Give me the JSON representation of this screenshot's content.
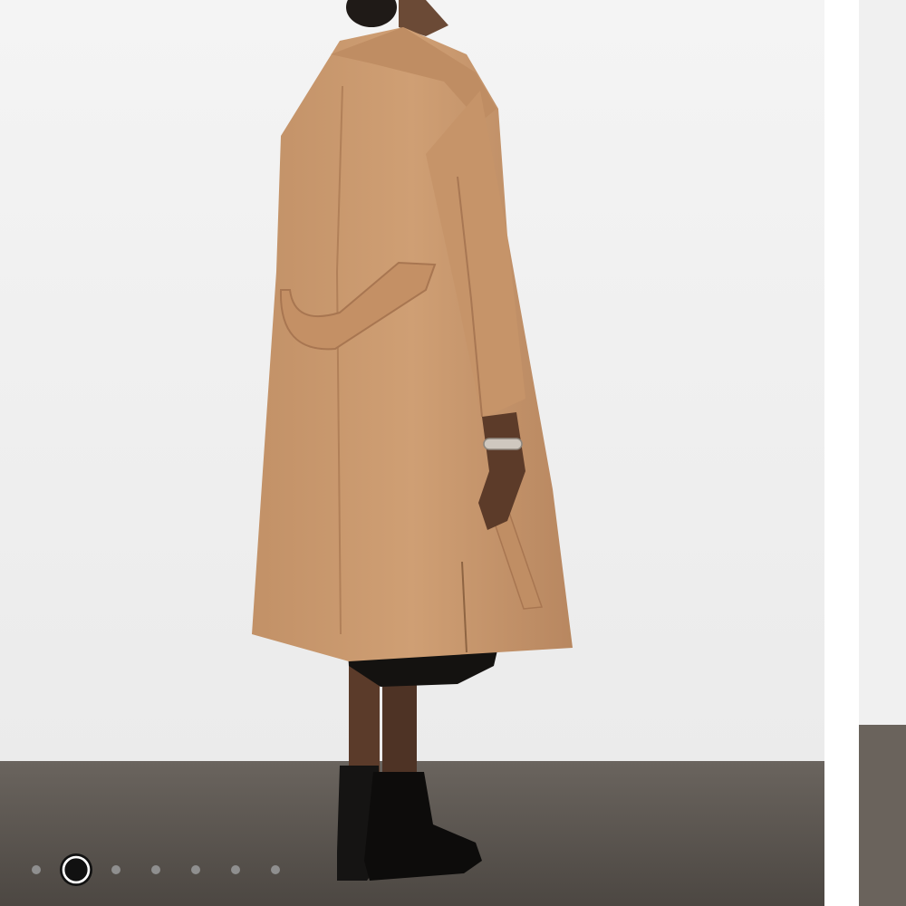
{
  "gallery": {
    "active_index": 1,
    "slide_count": 7,
    "dots": [
      {
        "state": "inactive"
      },
      {
        "state": "active"
      },
      {
        "state": "inactive"
      },
      {
        "state": "inactive"
      },
      {
        "state": "inactive"
      },
      {
        "state": "inactive"
      },
      {
        "state": "inactive"
      }
    ]
  },
  "colors": {
    "wall": "#f1f1f1",
    "floor": "#5a5550",
    "coat": "#c89a6e",
    "dot_inactive": "#8f8f8f",
    "dot_active": "#111111"
  }
}
